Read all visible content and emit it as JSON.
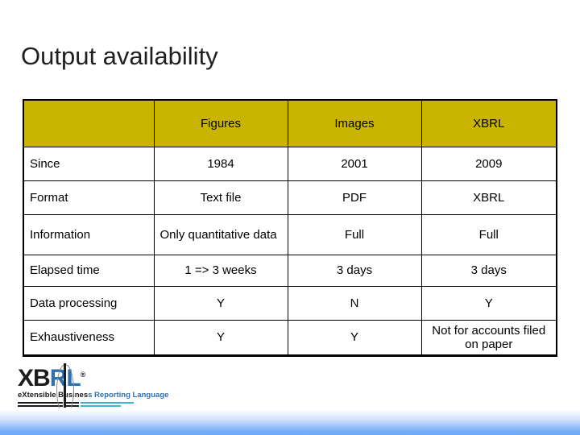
{
  "slide": {
    "title": "Output availability",
    "header_bg_color": "#c9b400",
    "footer_accent_color": "#6ba8f7"
  },
  "table": {
    "columns": [
      "",
      "Figures",
      "Images",
      "XBRL"
    ],
    "rows": [
      {
        "label": "Since",
        "cells": [
          "1984",
          "2001",
          "2009"
        ],
        "align": "center"
      },
      {
        "label": "Format",
        "cells": [
          "Text file",
          "PDF",
          "XBRL"
        ],
        "align": "center"
      },
      {
        "label": "Information",
        "cells": [
          "Only quantitative data",
          "Full",
          "Full"
        ],
        "align": "mixed"
      },
      {
        "label": "Elapsed time",
        "cells": [
          "1 => 3 weeks",
          "3 days",
          "3 days"
        ],
        "align": "center"
      },
      {
        "label": "Data processing",
        "cells": [
          "Y",
          "N",
          "Y"
        ],
        "align": "center"
      },
      {
        "label": "Exhaustiveness",
        "cells": [
          "Y",
          "Y",
          "Not for accounts filed on paper"
        ],
        "align": "center"
      }
    ]
  },
  "logo": {
    "word_part_1": "XB",
    "word_part_2": "RL",
    "registered_mark": "®",
    "tagline_part_1": "eXtensible Busines",
    "tagline_part_2": "s Reporting Language"
  }
}
